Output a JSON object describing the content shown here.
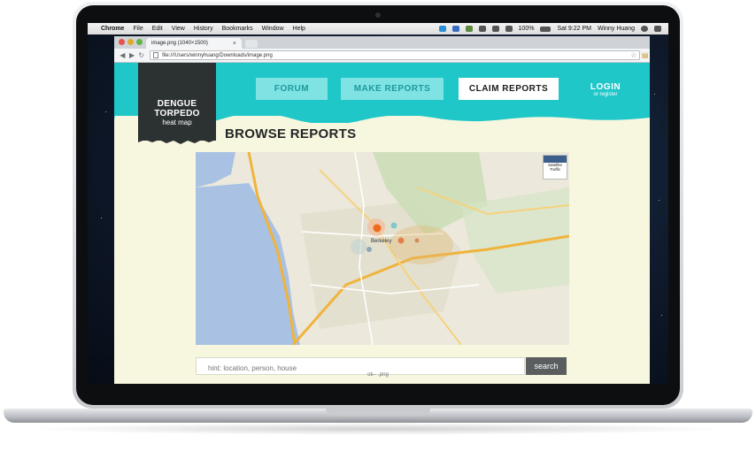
{
  "menubar": {
    "apple": "",
    "items": [
      "Chrome",
      "File",
      "Edit",
      "View",
      "History",
      "Bookmarks",
      "Window",
      "Help"
    ],
    "battery": "100%",
    "clock": "Sat 9:22 PM",
    "user": "Winny Huang"
  },
  "browser": {
    "tab_title": "image.png (1040×1500)",
    "tab_close": "×",
    "url": "file:///Users/winnyhuang/Downloads/image.png"
  },
  "site": {
    "logo_line1": "DENGUE",
    "logo_line2": "TORPEDO",
    "logo_line3": "heat map",
    "nav": {
      "forum": "FORUM",
      "make_reports": "MAKE REPORTS",
      "claim_reports": "CLAIM REPORTS",
      "login": "LOGIN",
      "register": "or register"
    },
    "page_title": "BROWSE REPORTS",
    "map": {
      "satellite_label": "Satellite",
      "traffic_label": "Traffic",
      "place_label": "Berkeley"
    },
    "search": {
      "placeholder": "hint: location, person, house",
      "button": "search"
    }
  },
  "laptop": {
    "chin_label": "ok-- .png"
  }
}
